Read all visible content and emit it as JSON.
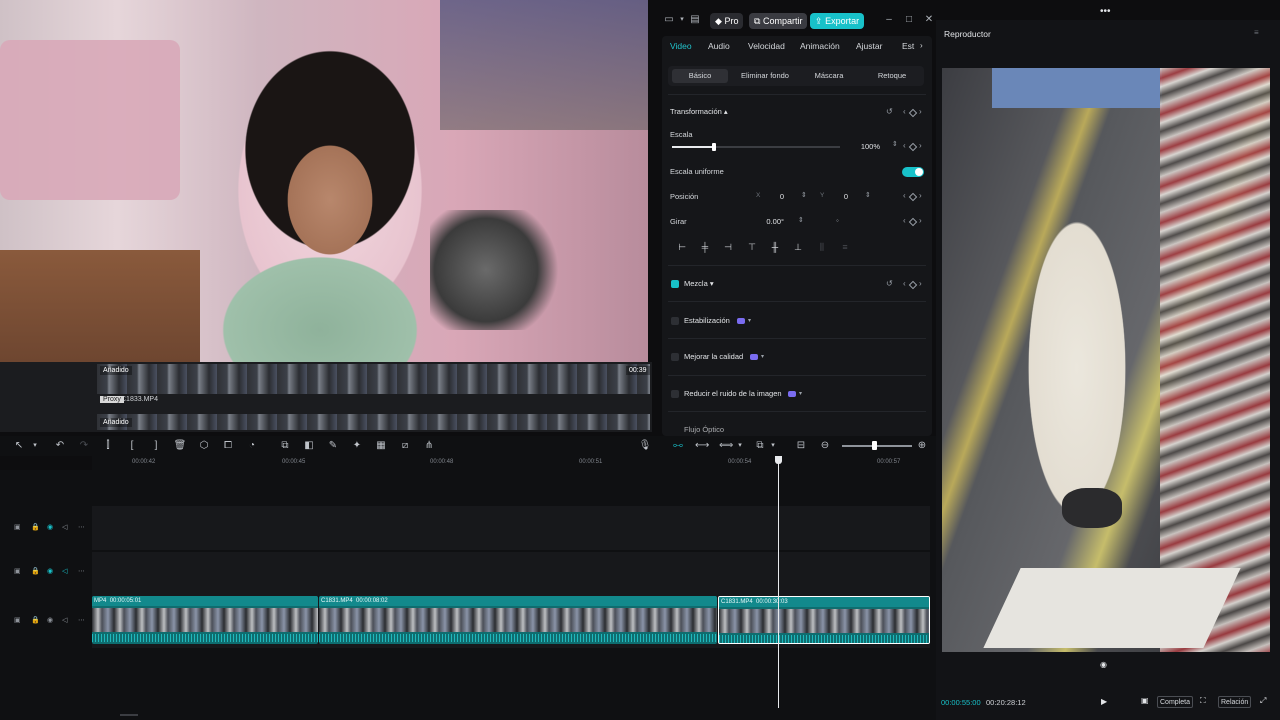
{
  "webcam": {
    "media_tag_top": "Añadido",
    "media_tag_bottom": "Añadido",
    "media_time": "00:39",
    "proxy_label": "Proxy",
    "clip_name": "C1833.MP4"
  },
  "window": {
    "pro_label": "Pro",
    "share_label": "Compartir",
    "export_label": "Exportar"
  },
  "props": {
    "tabs": [
      "Video",
      "Audio",
      "Velocidad",
      "Animación",
      "Ajustar",
      "Est"
    ],
    "subtabs": [
      "Básico",
      "Eliminar fondo",
      "Máscara",
      "Retoque"
    ],
    "transform_header": "Transformación",
    "scale_label": "Escala",
    "scale_value": "100%",
    "uniform_scale_label": "Escala uniforme",
    "position_label": "Posición",
    "pos_x_label": "X",
    "pos_x_value": "0",
    "pos_y_label": "Y",
    "pos_y_value": "0",
    "rotate_label": "Girar",
    "rotate_value": "0.00°",
    "blend_label": "Mezcla",
    "stabilization_label": "Estabilización",
    "enhance_label": "Mejorar la calidad",
    "denoise_label": "Reducir el ruido de la imagen",
    "optical_flow_label": "Flujo Óptico",
    "scale_level": 0.25,
    "accent_color": "#18c1c9"
  },
  "player": {
    "title": "Reproductor",
    "timecode": "00:00:55:00",
    "duration": "00:20:28:12",
    "quality_label": "Completa",
    "ratio_label": "Relación"
  },
  "timeline": {
    "ruler": [
      "00:00:42",
      "00:00:45",
      "00:00:48",
      "00:00:51",
      "00:00:54",
      "00:00:57"
    ],
    "clips": [
      {
        "name": "MP4",
        "time": "00:00:05:01"
      },
      {
        "name": "C1831.MP4",
        "time": "00:00:08:02"
      },
      {
        "name": "C1831.MP4",
        "time": "00:00:30:03"
      }
    ],
    "zoom_level": 0.45
  }
}
